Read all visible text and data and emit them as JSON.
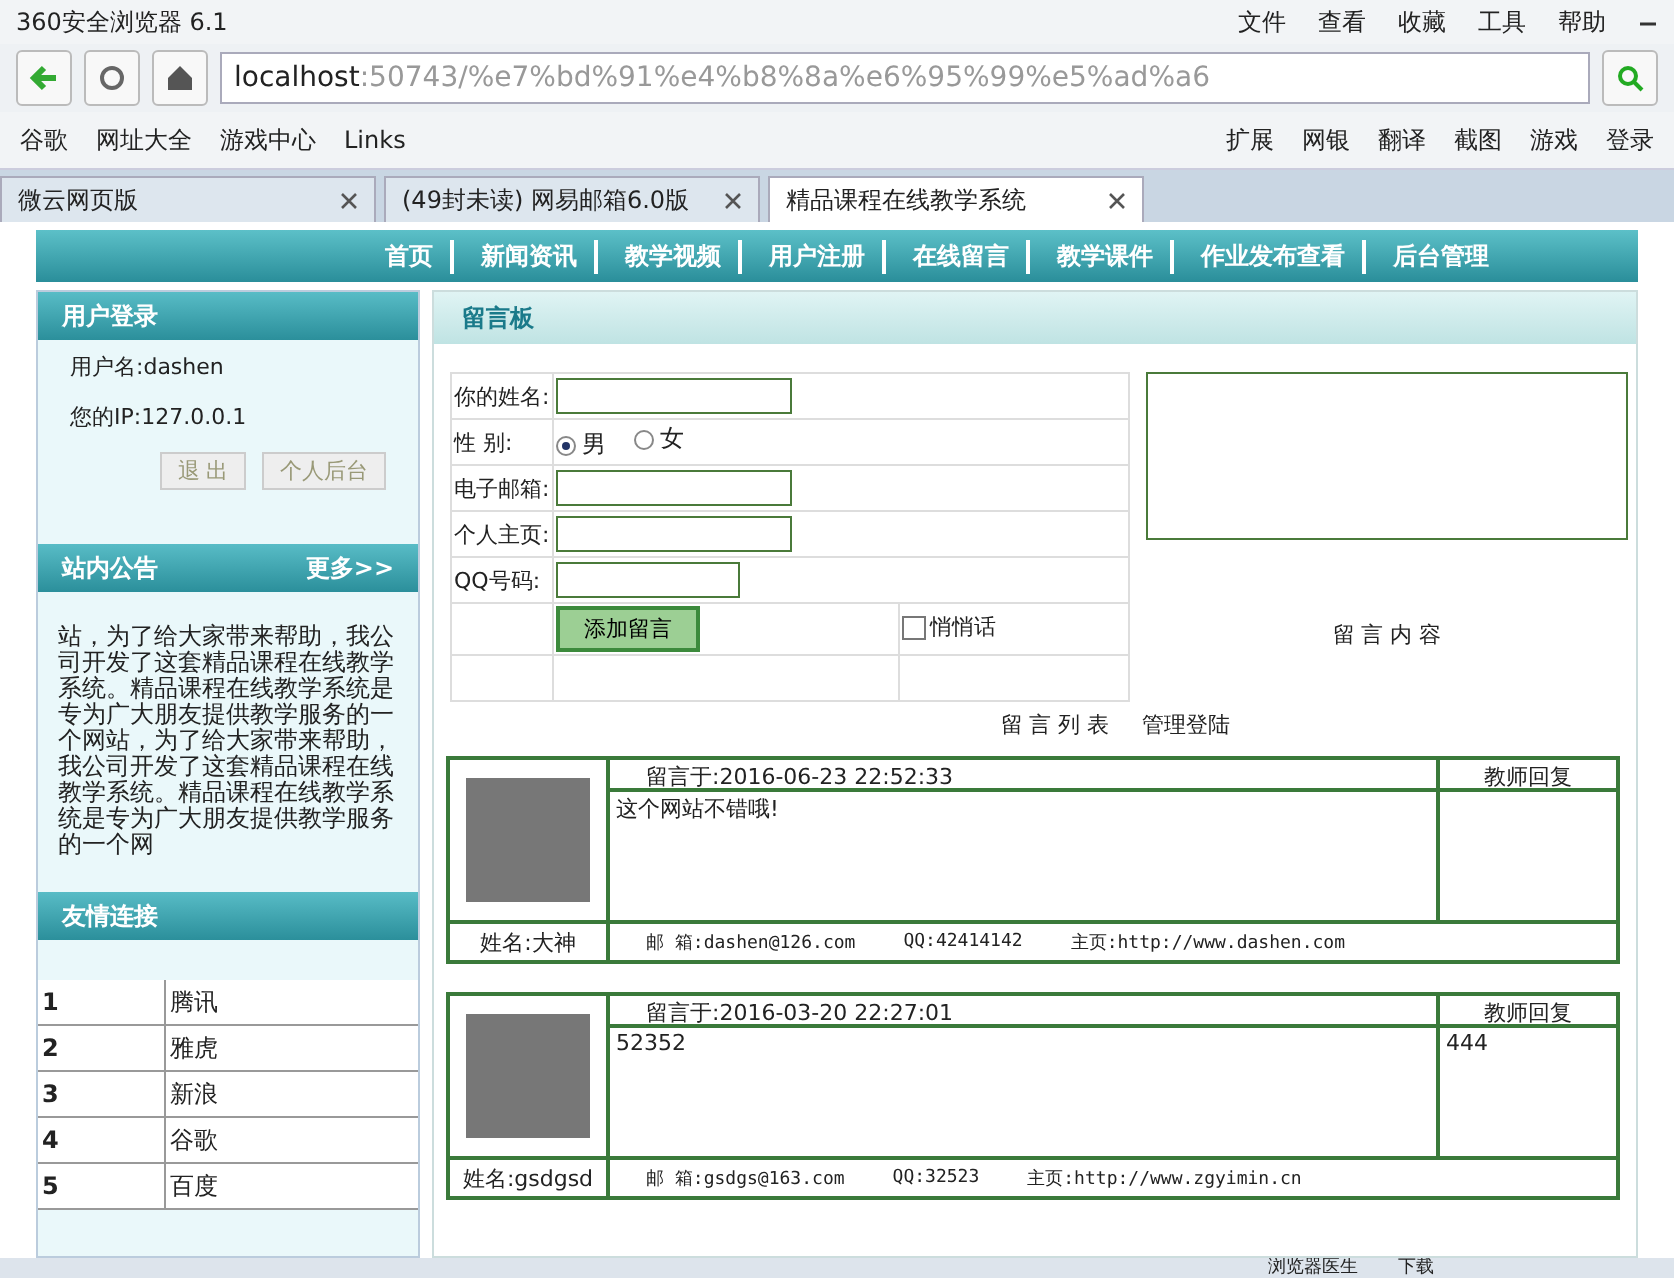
{
  "window": {
    "title": "360安全浏览器 6.1",
    "menu": [
      "文件",
      "查看",
      "收藏",
      "工具",
      "帮助"
    ]
  },
  "address_bar": {
    "url_host": "localhost",
    "url_rest": ":50743/%e7%bd%91%e4%b8%8a%e6%95%99%e5%ad%a6"
  },
  "bookmarks": [
    "谷歌",
    "网址大全",
    "游戏中心",
    "Links"
  ],
  "toolbar_right": [
    "扩展",
    "网银",
    "翻译",
    "截图",
    "游戏",
    "登录"
  ],
  "tabs": [
    {
      "label": "微云网页版",
      "selected": false
    },
    {
      "label": "(49封未读) 网易邮箱6.0版",
      "selected": false
    },
    {
      "label": "精品课程在线教学系统",
      "selected": true
    }
  ],
  "nav": [
    "首页",
    "新闻资讯",
    "教学视频",
    "用户注册",
    "在线留言",
    "教学课件",
    "作业发布查看",
    "后台管理"
  ],
  "login": {
    "title": "用户登录",
    "username": "用户名:dashen",
    "ip": "您的IP:127.0.0.1",
    "buttons": [
      "退 出",
      "个人后台"
    ]
  },
  "notice": {
    "title": "站内公告",
    "more": "更多>>",
    "text": "站，为了给大家带来帮助，我公司开发了这套精品课程在线教学系统。精品课程在线教学系统是专为广大朋友提供教学服务的一个网站，为了给大家带来帮助，我公司开发了这套精品课程在线教学系统。精品课程在线教学系统是专为广大朋友提供教学服务的一个网"
  },
  "links": {
    "title": "友情连接",
    "rows": [
      {
        "no": "1",
        "name": "腾讯"
      },
      {
        "no": "2",
        "name": "雅虎"
      },
      {
        "no": "3",
        "name": "新浪"
      },
      {
        "no": "4",
        "name": "谷歌"
      },
      {
        "no": "5",
        "name": "百度"
      }
    ]
  },
  "board": {
    "title": "留言板",
    "name_label": "你的姓名:",
    "gender_label": "性  别:",
    "genders": [
      {
        "label": "男",
        "selected": true
      },
      {
        "label": "女",
        "selected": false
      }
    ],
    "email_label": "电子邮箱:",
    "homepage_label": "个人主页:",
    "qq_label": "QQ号码:",
    "submit": "添加留言",
    "whisper": {
      "label": "悄悄话",
      "checked": false
    },
    "content_label": "留 言 内 容",
    "list_link": "留 言 列 表",
    "admin_link": "管理登陆"
  },
  "messages": [
    {
      "time": "留言于:2016-06-23 22:52:33",
      "reply_label": "教师回复",
      "content": "这个网站不错哦!",
      "name": "姓名:大神",
      "email": "邮 箱:dashen@126.com",
      "qq": "QQ:42414142",
      "homepage": "主页:http://www.dashen.com"
    },
    {
      "time": "留言于:2016-03-20 22:27:01",
      "reply_label": "教师回复",
      "content": "52352",
      "reply": "444",
      "name": "姓名:gsdgsd",
      "email": "邮 箱:gsdgs@163.com",
      "qq": "QQ:32523",
      "homepage": "主页:http://www.zgyimin.cn"
    }
  ],
  "status_bar": [
    "浏览器医生",
    "下载"
  ]
}
